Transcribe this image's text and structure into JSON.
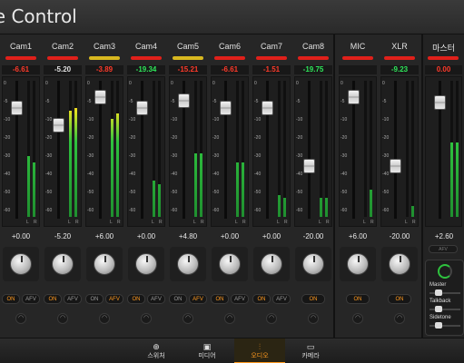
{
  "app_title": "re Control",
  "colors": {
    "accent": "#ff9a1f",
    "tally_red": "#e0201a",
    "tally_yellow": "#d8b81f",
    "peak_red": "#ff3a2a",
    "peak_green": "#2ee85a"
  },
  "channels": [
    {
      "name": "Cam1",
      "peak": "-6.61",
      "peak_color": "red",
      "tally": "red",
      "gain": "+0.00",
      "fader": 0.84,
      "meter_l": 0.45,
      "meter_r": 0.4,
      "btn_on": "ON",
      "btn_afv": "AFV",
      "on_active": true,
      "afv_active": false
    },
    {
      "name": "Cam2",
      "peak": "-5.20",
      "peak_color": "",
      "tally": "red",
      "gain": "-5.20",
      "fader": 0.7,
      "meter_l": 0.78,
      "meter_r": 0.8,
      "btn_on": "ON",
      "btn_afv": "AFV",
      "on_active": true,
      "afv_active": false
    },
    {
      "name": "Cam3",
      "peak": "-3.89",
      "peak_color": "red",
      "tally": "yellow",
      "gain": "+6.00",
      "fader": 0.93,
      "meter_l": 0.72,
      "meter_r": 0.76,
      "btn_on": "ON",
      "btn_afv": "AFV",
      "on_active": false,
      "afv_active": true
    },
    {
      "name": "Cam4",
      "peak": "-19.34",
      "peak_color": "green",
      "tally": "red",
      "gain": "+0.00",
      "fader": 0.84,
      "meter_l": 0.27,
      "meter_r": 0.24,
      "btn_on": "ON",
      "btn_afv": "AFV",
      "on_active": true,
      "afv_active": false
    },
    {
      "name": "Cam5",
      "peak": "-15.21",
      "peak_color": "red",
      "tally": "yellow",
      "gain": "+4.80",
      "fader": 0.9,
      "meter_l": 0.47,
      "meter_r": 0.47,
      "btn_on": "ON",
      "btn_afv": "AFV",
      "on_active": false,
      "afv_active": true
    },
    {
      "name": "Cam6",
      "peak": "-6.61",
      "peak_color": "red",
      "tally": "red",
      "gain": "+0.00",
      "fader": 0.84,
      "meter_l": 0.4,
      "meter_r": 0.4,
      "btn_on": "ON",
      "btn_afv": "AFV",
      "on_active": true,
      "afv_active": false
    },
    {
      "name": "Cam7",
      "peak": "-1.51",
      "peak_color": "red",
      "tally": "red",
      "gain": "+0.00",
      "fader": 0.84,
      "meter_l": 0.16,
      "meter_r": 0.14,
      "btn_on": "ON",
      "btn_afv": "AFV",
      "on_active": true,
      "afv_active": false
    },
    {
      "name": "Cam8",
      "peak": "-19.75",
      "peak_color": "green",
      "tally": "red",
      "gain": "-20.00",
      "fader": 0.37,
      "meter_l": 0.14,
      "meter_r": 0.14,
      "btn_on": "ON",
      "btn_afv": "",
      "on_active": true,
      "afv_active": false
    },
    {
      "name": "MIC",
      "peak": "",
      "peak_color": "",
      "tally": "red",
      "gain": "+6.00",
      "fader": 0.93,
      "meter_l": 0.0,
      "meter_r": 0.2,
      "btn_on": "ON",
      "btn_afv": "",
      "on_active": true,
      "afv_active": false
    },
    {
      "name": "XLR",
      "peak": "-9.23",
      "peak_color": "green",
      "tally": "red",
      "gain": "-20.00",
      "fader": 0.37,
      "meter_l": 0.0,
      "meter_r": 0.08,
      "btn_on": "ON",
      "btn_afv": "",
      "on_active": true,
      "afv_active": false
    }
  ],
  "scale": [
    "0",
    "-5",
    "-10",
    "-20",
    "-30",
    "-40",
    "-50",
    "-60"
  ],
  "lr_label": "L R",
  "master": {
    "name": "마스터",
    "peak": "0.00",
    "gain": "+2.60",
    "fader": 0.88,
    "meter_l": 0.55,
    "meter_r": 0.55,
    "afv_label": "AFV",
    "headphones": {
      "master_label": "Master",
      "talkback_label": "Talkback",
      "sidetone_label": "Sidetone"
    }
  },
  "tabs": [
    {
      "id": "switcher",
      "label": "스위처",
      "icon": "⊕",
      "active": false
    },
    {
      "id": "media",
      "label": "미디어",
      "icon": "▣",
      "active": false
    },
    {
      "id": "audio",
      "label": "오디오",
      "icon": "⫶",
      "active": true
    },
    {
      "id": "camera",
      "label": "카메라",
      "icon": "▭",
      "active": false
    }
  ]
}
